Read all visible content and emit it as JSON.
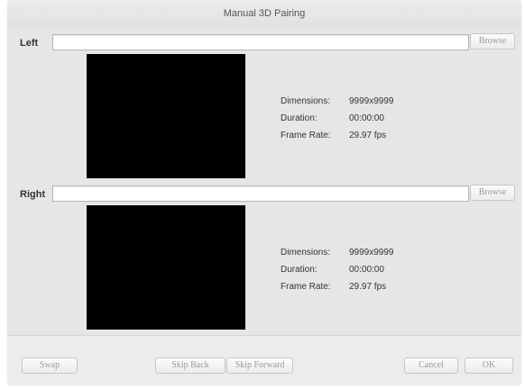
{
  "window": {
    "title": "Manual 3D Pairing"
  },
  "left": {
    "label": "Left",
    "path_value": "",
    "browse_label": "Browse",
    "dimensions_label": "Dimensions:",
    "dimensions_value": "9999x9999",
    "duration_label": "Duration:",
    "duration_value": "00:00:00",
    "frame_rate_label": "Frame Rate:",
    "frame_rate_value": "29.97 fps"
  },
  "right": {
    "label": "Right",
    "path_value": "",
    "browse_label": "Browse",
    "dimensions_label": "Dimensions:",
    "dimensions_value": "9999x9999",
    "duration_label": "Duration:",
    "duration_value": "00:00:00",
    "frame_rate_label": "Frame Rate:",
    "frame_rate_value": "29.97 fps"
  },
  "footer": {
    "swap_label": "Swap",
    "skip_back_label": "Skip Back",
    "skip_forward_label": "Skip Forward",
    "cancel_label": "Cancel",
    "ok_label": "OK"
  }
}
